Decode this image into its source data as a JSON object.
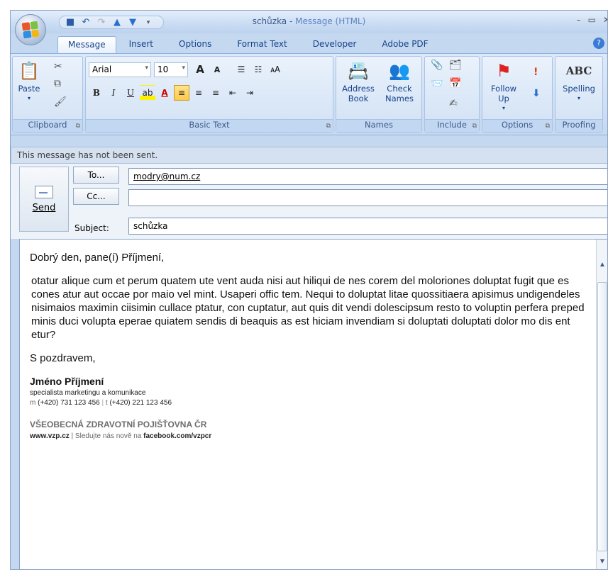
{
  "window": {
    "title": "schůzka",
    "title_sep": " - ",
    "title_kind": "Message (HTML)",
    "min": "–",
    "max": "▭",
    "close": "✕"
  },
  "tabs": [
    "Message",
    "Insert",
    "Options",
    "Format Text",
    "Developer",
    "Adobe PDF"
  ],
  "help_label": "?",
  "ribbon": {
    "clipboard": {
      "paste": "Paste",
      "group": "Clipboard"
    },
    "basic_text": {
      "font": "Arial",
      "size": "10",
      "group": "Basic Text",
      "bold": "B",
      "italic": "I",
      "underline": "U",
      "grow": "A",
      "shrink": "A"
    },
    "names": {
      "address_book": "Address Book",
      "check_names": "Check Names",
      "group": "Names"
    },
    "include": {
      "group": "Include"
    },
    "options": {
      "follow_up": "Follow Up",
      "group": "Options"
    },
    "proofing": {
      "spelling": "Spelling",
      "abc": "ABC",
      "group": "Proofing"
    }
  },
  "infobar": "This message has not been sent.",
  "header": {
    "send": "Send",
    "to_button": "To...",
    "cc_button": "Cc...",
    "subject_label": "Subject:",
    "to_value": "modry@num.cz",
    "cc_value": "",
    "subject_value": "schůzka"
  },
  "message": {
    "greeting": "Dobrý den, pane(í) Příjmení,",
    "paragraph": "otatur alique cum et perum quatem ute vent auda nisi aut hiliqui de nes corem del moloriones doluptat fugit que es cones atur aut occae por maio vel mint. Usaperi offic tem. Nequi to doluptat litae quossitiaera apisimus undigendeles nisimaios maximin ciisimin cullace ptatur, con cuptatur, aut quis dit vendi dolescipsum resto to voluptin perfera preped minis duci volupta eperae quiatem sendis di beaquis as est hiciam invendiam si doluptati doluptati dolor mo dis ent etur?",
    "closing": "S pozdravem,",
    "sig_name": "Jméno Příjmení",
    "sig_role": "specialista marketingu a komunikace",
    "sig_m_label": "m",
    "sig_m": "(+420) 731 123 456",
    "sig_sep": "|",
    "sig_t_label": "t",
    "sig_t": "(+420) 221 123 456",
    "company": "VŠEOBECNÁ ZDRAVOTNÍ POJIŠŤOVNA ČR",
    "web": "www.vzp.cz",
    "web_text": "| Sledujte nás nově na",
    "facebook": "facebook.com/vzpcr"
  },
  "colors": {
    "accent": "#15428b",
    "ribbon": "#c6d9f1",
    "highlight": "#ffc94a"
  }
}
